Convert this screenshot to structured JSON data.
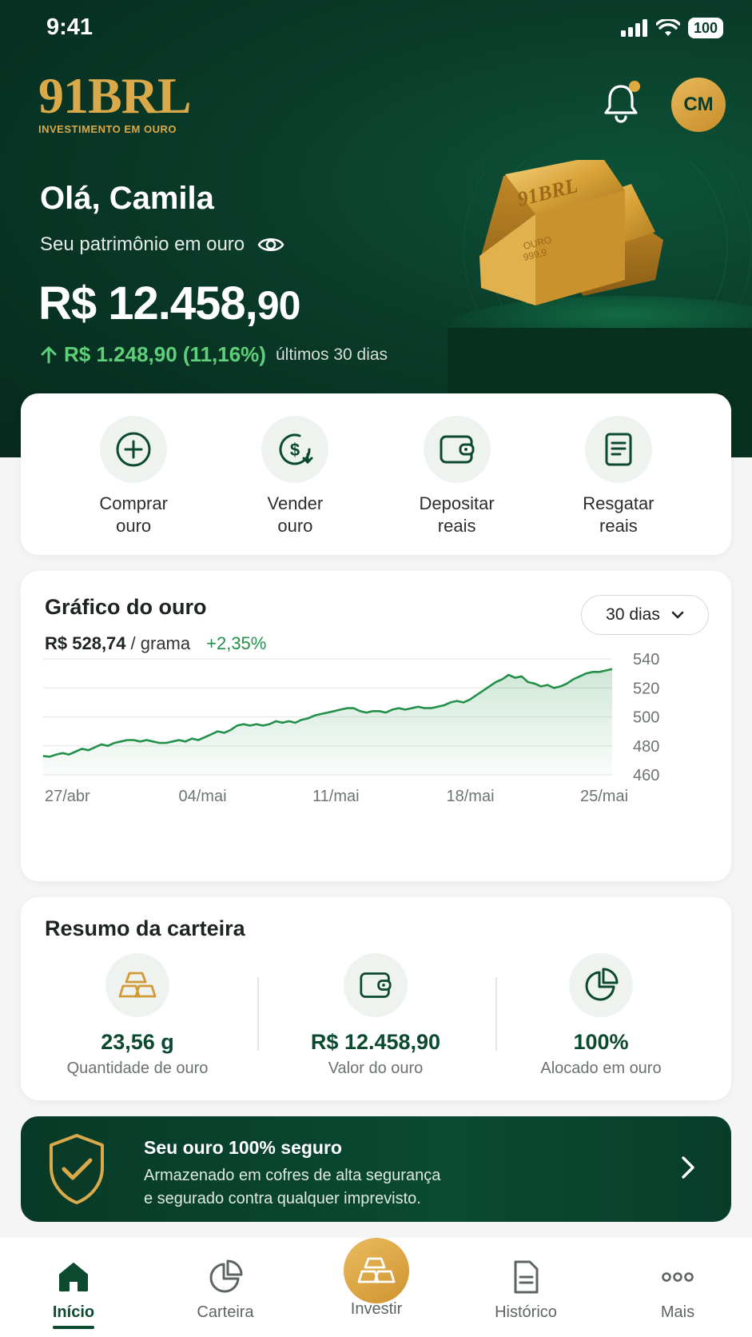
{
  "status_bar": {
    "time": "9:41",
    "battery": "100"
  },
  "brand": {
    "name": "91BRL",
    "tagline": "INVESTIMENTO EM OURO"
  },
  "user": {
    "initials": "CM",
    "greeting": "Olá, Camila"
  },
  "hero": {
    "subtitle": "Seu patrimônio em ouro",
    "balance_main": "R$ 12.458,",
    "balance_cents": "90",
    "variation": "R$ 1.248,90 (11,16%)",
    "variation_period": "últimos 30 dias",
    "bar_engraving": "91BRL",
    "bar_small_1": "OURO",
    "bar_small_2": "999,9"
  },
  "actions": [
    {
      "line1": "Comprar",
      "line2": "ouro",
      "icon": "plus-circle-icon"
    },
    {
      "line1": "Vender",
      "line2": "ouro",
      "icon": "dollar-exchange-icon"
    },
    {
      "line1": "Depositar",
      "line2": "reais",
      "icon": "wallet-icon"
    },
    {
      "line1": "Resgatar",
      "line2": "reais",
      "icon": "document-icon"
    }
  ],
  "chart_card": {
    "title": "Gráfico do ouro",
    "price": "R$ 528,74",
    "unit": "/ grama",
    "change": "+2,35%",
    "period": "30 dias"
  },
  "chart_data": {
    "type": "area",
    "x_labels": [
      "27/abr",
      "04/mai",
      "11/mai",
      "18/mai",
      "25/mai"
    ],
    "y_ticks": [
      540,
      520,
      500,
      480,
      460
    ],
    "ylim": [
      460,
      540
    ],
    "grid": true,
    "color": "#23914a",
    "values": [
      473,
      472.5,
      474,
      475,
      474,
      476,
      478,
      477,
      479,
      481,
      480,
      482,
      483,
      484,
      484,
      483,
      484,
      483,
      482,
      482,
      483,
      484,
      483,
      485,
      484,
      486,
      488,
      490,
      489,
      491,
      494,
      495,
      494,
      495,
      494,
      495,
      497,
      496,
      497,
      496,
      498,
      499,
      501,
      502,
      503,
      504,
      505,
      506,
      506,
      504,
      503,
      504,
      504,
      503,
      505,
      506,
      505,
      506,
      507,
      506,
      506,
      507,
      508,
      510,
      511,
      510,
      512,
      515,
      518,
      521,
      524,
      526,
      529,
      527,
      528,
      524,
      523,
      521,
      522,
      520,
      521,
      523,
      526,
      528,
      530,
      531,
      531,
      532,
      533
    ]
  },
  "summary": {
    "title": "Resumo da carteira",
    "items": [
      {
        "value": "23,56 g",
        "caption": "Quantidade de ouro",
        "icon": "gold-bars-icon"
      },
      {
        "value": "R$ 12.458,90",
        "caption": "Valor do ouro",
        "icon": "wallet-icon"
      },
      {
        "value": "100%",
        "caption": "Alocado em ouro",
        "icon": "pie-chart-icon"
      }
    ]
  },
  "security_banner": {
    "title": "Seu ouro 100% seguro",
    "line1": "Armazenado em cofres de alta segurança",
    "line2": "e segurado contra qualquer imprevisto."
  },
  "nav": {
    "items": [
      {
        "label": "Início",
        "icon": "home-icon",
        "active": true
      },
      {
        "label": "Carteira",
        "icon": "pie-chart-icon"
      },
      {
        "label": "Investir",
        "icon": "gold-bars-icon"
      },
      {
        "label": "Histórico",
        "icon": "document-icon"
      },
      {
        "label": "Mais",
        "icon": "more-icon"
      }
    ]
  },
  "colors": {
    "primary": "#0a3b29",
    "gold": "#d9a94a",
    "positive": "#23914a"
  }
}
